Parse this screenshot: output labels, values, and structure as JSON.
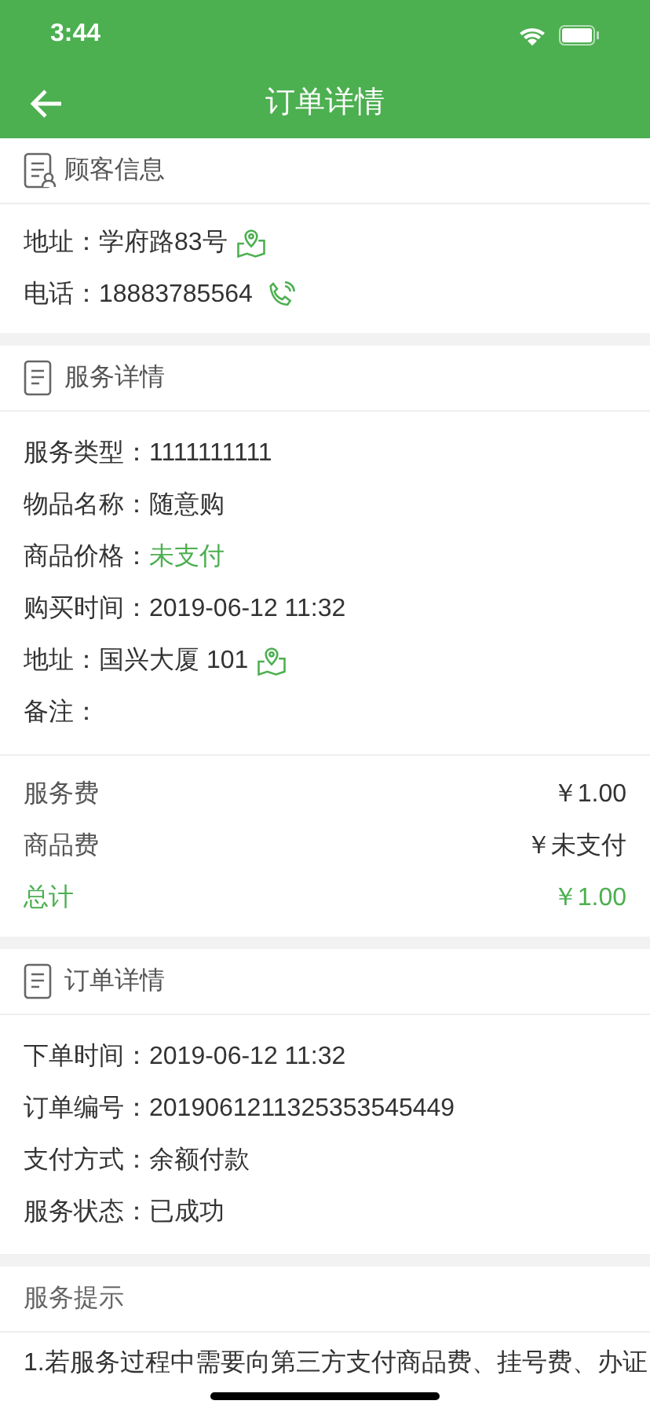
{
  "status_bar": {
    "time": "3:44"
  },
  "header": {
    "title": "订单详情"
  },
  "customer": {
    "title": "顾客信息",
    "rows": [
      {
        "label": "地址：",
        "value": "学府路83号",
        "kind": "map"
      },
      {
        "label": "电话：",
        "value": "18883785564",
        "kind": "phone"
      }
    ]
  },
  "service": {
    "title": "服务详情",
    "rows": [
      {
        "label": "服务类型：",
        "value": "1111111111"
      },
      {
        "label": "物品名称：",
        "value": "随意购"
      },
      {
        "label": "商品价格：",
        "value": "未支付",
        "highlight": true
      },
      {
        "label": "购买时间：",
        "value": "2019-06-12 11:32"
      },
      {
        "label": "地址：",
        "value": "国兴大厦 101",
        "kind": "map"
      },
      {
        "label": "备注："
      }
    ],
    "fees": [
      {
        "label": "服务费",
        "value": "￥1.00",
        "highlight": false
      },
      {
        "label": "商品费",
        "value": "￥未支付",
        "highlight": false
      },
      {
        "label": "总计",
        "value": "￥1.00",
        "highlight": true
      }
    ]
  },
  "order": {
    "title": "订单详情",
    "rows": [
      {
        "label": "下单时间：",
        "value": "2019-06-12 11:32"
      },
      {
        "label": "订单编号：",
        "value": "2019061211325353545449"
      },
      {
        "label": "支付方式：",
        "value": "余额付款"
      },
      {
        "label": "服务状态：",
        "value": "已成功"
      }
    ]
  },
  "tips": {
    "title": "服务提示",
    "text": "1.若服务过程中需要向第三方支付商品费、挂号费、办证"
  }
}
